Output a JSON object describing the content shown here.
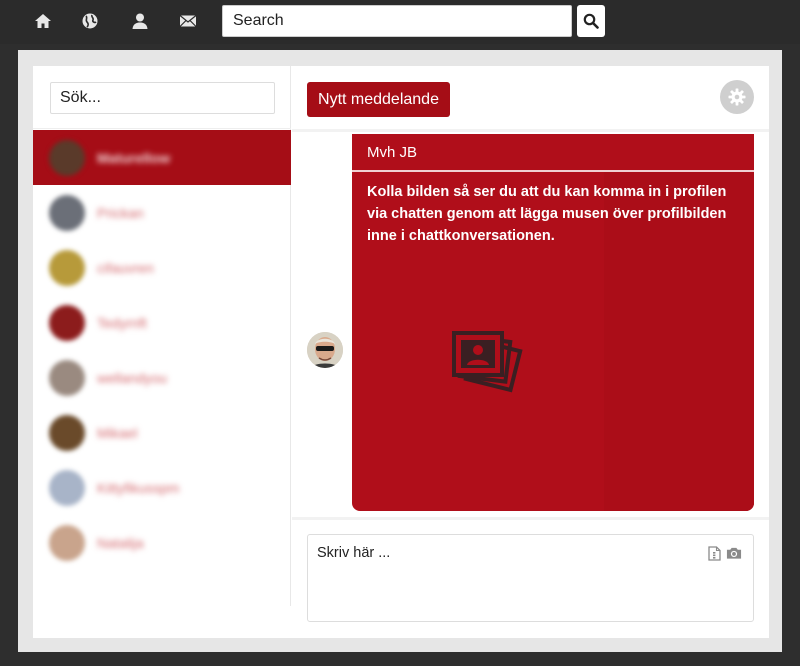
{
  "topbar": {
    "icons": [
      "home-icon",
      "globe-icon",
      "user-icon",
      "envelope-icon"
    ],
    "search_placeholder": "Search",
    "search_button_icon": "search-icon"
  },
  "sidebar": {
    "search_placeholder": "Sök...",
    "contacts": [
      {
        "name": "Maturellow",
        "active": true,
        "avatar_color": "#5a3a2a"
      },
      {
        "name": "Prickan",
        "active": false,
        "avatar_color": "#6b6f78"
      },
      {
        "name": "cifauvren",
        "active": false,
        "avatar_color": "#b79a3a"
      },
      {
        "name": "Tedyrnft",
        "active": false,
        "avatar_color": "#8c1c1c"
      },
      {
        "name": "wellandyou",
        "active": false,
        "avatar_color": "#9a8a80"
      },
      {
        "name": "Mikael",
        "active": false,
        "avatar_color": "#6a4a2a"
      },
      {
        "name": "Kittyfikusspm",
        "active": false,
        "avatar_color": "#a8b4c8"
      },
      {
        "name": "Natalija",
        "active": false,
        "avatar_color": "#c9a48c"
      }
    ]
  },
  "conversation": {
    "new_message_label": "Nytt meddelande",
    "settings_icon": "gear-icon",
    "message": {
      "subject": "Mvh JB",
      "body": "Kolla bilden så ser du att du kan komma in i profilen via chatten genom att lägga musen över profilbilden inne i chattkonversationen.",
      "attachment_icon": "photos-icon"
    },
    "compose": {
      "placeholder": "Skriv här ...",
      "icons": [
        "file-icon",
        "camera-icon"
      ]
    }
  },
  "colors": {
    "accent": "#a50d16",
    "bubble": "#b00e1a",
    "topbar": "#2b2b2b"
  }
}
